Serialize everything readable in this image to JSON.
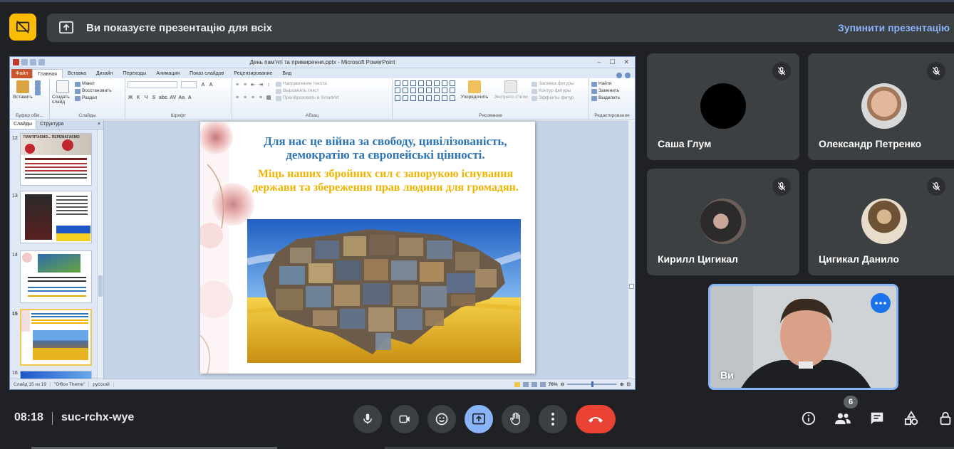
{
  "banner": {
    "text": "Ви показуєте презентацію для всіх",
    "stop_label": "Зупинити презентацію"
  },
  "ppt": {
    "window_title": "День пам'яті та примирення.pptx - Microsoft PowerPoint",
    "file_tab": "Файл",
    "tabs": [
      "Главная",
      "Вставка",
      "Дизайн",
      "Переходы",
      "Анимация",
      "Показ слайдов",
      "Рецензирование",
      "Вид"
    ],
    "ribbon": {
      "clipboard": {
        "paste": "Вставить",
        "label": "Буфер обм..."
      },
      "slides": {
        "new_slide": "Создать слайд",
        "layout": "Макет",
        "reset": "Восстановить",
        "section": "Раздел",
        "label": "Слайды"
      },
      "font": {
        "label": "Шрифт"
      },
      "paragraph": {
        "text_dir": "Направление текста",
        "align_text": "Выровнять текст",
        "smartart": "Преобразовать в SmartArt",
        "label": "Абзац"
      },
      "drawing": {
        "arrange": "Упорядочить",
        "quick_styles": "Экспресс-стили",
        "fill": "Заливка фигуры",
        "outline": "Контур фигуры",
        "effects": "Эффекты фигур",
        "label": "Рисование"
      },
      "editing": {
        "find": "Найти",
        "replace": "Заменить",
        "select": "Выделить",
        "label": "Редактирование"
      }
    },
    "panel": {
      "tab_slides": "Слайды",
      "tab_outline": "Структура",
      "close": "×",
      "thumbnails": [
        {
          "num": "12",
          "title": "ПАМ'ЯТАЄМО... ПЕРЕМАГАЄМО"
        },
        {
          "num": "13",
          "title": ""
        },
        {
          "num": "14",
          "title": ""
        },
        {
          "num": "15",
          "title": "Для нас це війна за свободу"
        },
        {
          "num": "16",
          "title": ""
        }
      ]
    },
    "slide": {
      "heading": "Для нас це війна за свободу, цивілізованість, демократію та європейські цінності.",
      "subheading": "Міць наших збройних сил є запорукою існування держави та збереження прав людини для громадян."
    },
    "status": {
      "slide_count": "Слайд 15 из 19",
      "theme": "\"Office Theme\"",
      "language": "русский",
      "zoom": "76%"
    }
  },
  "participants": [
    {
      "name": "Саша Глум",
      "muted": true
    },
    {
      "name": "Олександр Петренко",
      "muted": true
    },
    {
      "name": "Кирилл Цигикал",
      "muted": true
    },
    {
      "name": "Цигикал Данило",
      "muted": true
    }
  ],
  "self_tile": {
    "name": "Ви"
  },
  "meeting": {
    "time": "08:18",
    "code": "suc-rchx-wye",
    "participant_count": "6"
  },
  "colors": {
    "accent": "#8ab4f8",
    "end_call": "#ea4335",
    "present_icon_bg": "#fbbc04",
    "background": "#202124",
    "tile": "#3c4043"
  },
  "icons": {
    "share": "present-to-all-icon",
    "mic": "mic-icon",
    "camera": "videocam-icon",
    "emoji": "emoji-icon",
    "present": "present-icon",
    "hand": "raise-hand-icon",
    "more": "more-vert-icon",
    "end": "call-end-icon",
    "info": "info-icon",
    "people": "people-icon",
    "chat": "chat-icon",
    "activities": "activities-icon",
    "lock": "host-controls-icon"
  }
}
